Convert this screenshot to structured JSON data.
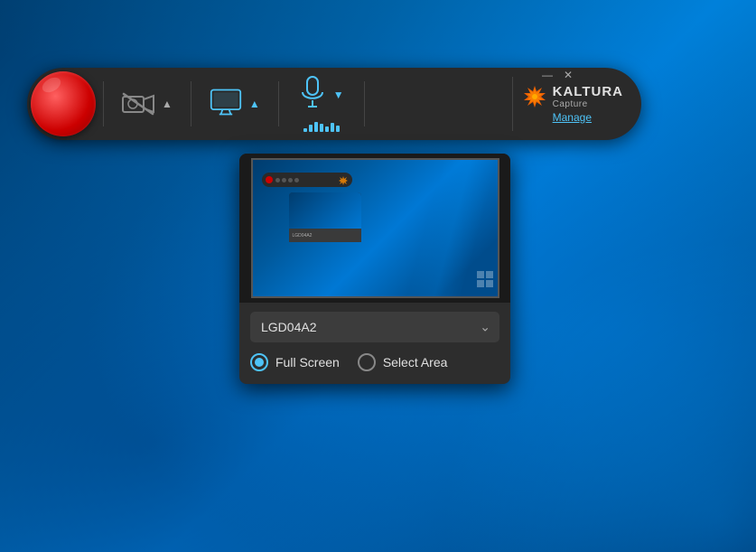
{
  "desktop": {
    "bg_color_start": "#003c6e",
    "bg_color_end": "#0078d4"
  },
  "toolbar": {
    "record_btn_label": "Record",
    "camera_label": "Camera",
    "monitor_label": "Screen",
    "mic_label": "Microphone",
    "window_minimize": "—",
    "window_close": "✕"
  },
  "kaltura": {
    "name": "KALTURA",
    "capture": "Capture",
    "manage_label": "Manage"
  },
  "screen_dropdown": {
    "monitor_name": "LGD04A2",
    "full_screen_label": "Full Screen",
    "select_area_label": "Select Area",
    "selected_option": "full_screen",
    "chevron": "⌄"
  }
}
